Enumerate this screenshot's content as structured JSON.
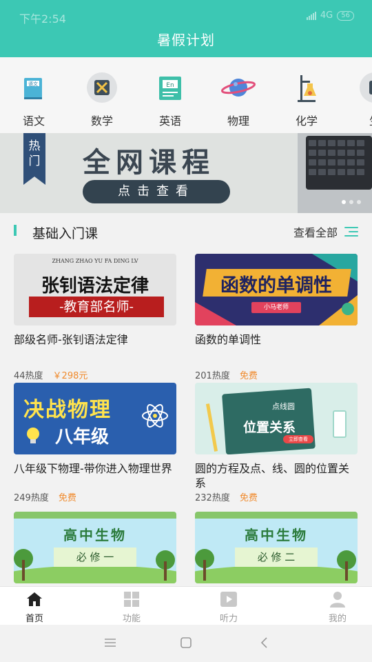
{
  "status": {
    "time": "下午2:54",
    "network": "4G",
    "battery": "56"
  },
  "header": {
    "title": "暑假计划"
  },
  "subjects": [
    {
      "label": "语文",
      "icon": "chinese-book-icon"
    },
    {
      "label": "数学",
      "icon": "math-calculator-icon"
    },
    {
      "label": "英语",
      "icon": "english-book-icon"
    },
    {
      "label": "物理",
      "icon": "physics-planet-icon"
    },
    {
      "label": "化学",
      "icon": "chemistry-flask-icon"
    },
    {
      "label": "生",
      "icon": "biology-icon"
    }
  ],
  "banner": {
    "tag": "热门",
    "title": "全网课程",
    "button": "点击查看"
  },
  "section": {
    "title": "基础入门课",
    "more": "查看全部"
  },
  "courses": [
    {
      "title": "部级名师-张钊语法定律",
      "heat": "44热度",
      "price": "￥298元",
      "thumb_small": "ZHANG ZHAO YU FA DING LV",
      "thumb_main": "张钊语法定律",
      "thumb_sub": "-教育部名师-"
    },
    {
      "title": "函数的单调性",
      "heat": "201热度",
      "price": "免费",
      "thumb_main": "函数的单调性",
      "thumb_sub": "小马老师"
    },
    {
      "title": "八年级下物理-带你进入物理世界",
      "heat": "249热度",
      "price": "免费",
      "thumb_main": "决战物理",
      "thumb_sub": "八年级"
    },
    {
      "title": "圆的方程及点、线、圆的位置关系",
      "heat": "232热度",
      "price": "免费",
      "thumb_main": "位置关系",
      "thumb_small": "点线圆",
      "thumb_sub": "立即查看"
    },
    {
      "title": "",
      "thumb_main": "高中生物",
      "thumb_sub": "必 修 一"
    },
    {
      "title": "",
      "thumb_main": "高中生物",
      "thumb_sub": "必 修 二"
    }
  ],
  "tabs": [
    {
      "label": "首页",
      "icon": "home-icon",
      "active": true
    },
    {
      "label": "功能",
      "icon": "grid-icon",
      "active": false
    },
    {
      "label": "听力",
      "icon": "play-icon",
      "active": false
    },
    {
      "label": "我的",
      "icon": "user-icon",
      "active": false
    }
  ],
  "colors": {
    "accent": "#3cc8b4",
    "price": "#f08a2c",
    "banner_dark": "#33434f"
  }
}
